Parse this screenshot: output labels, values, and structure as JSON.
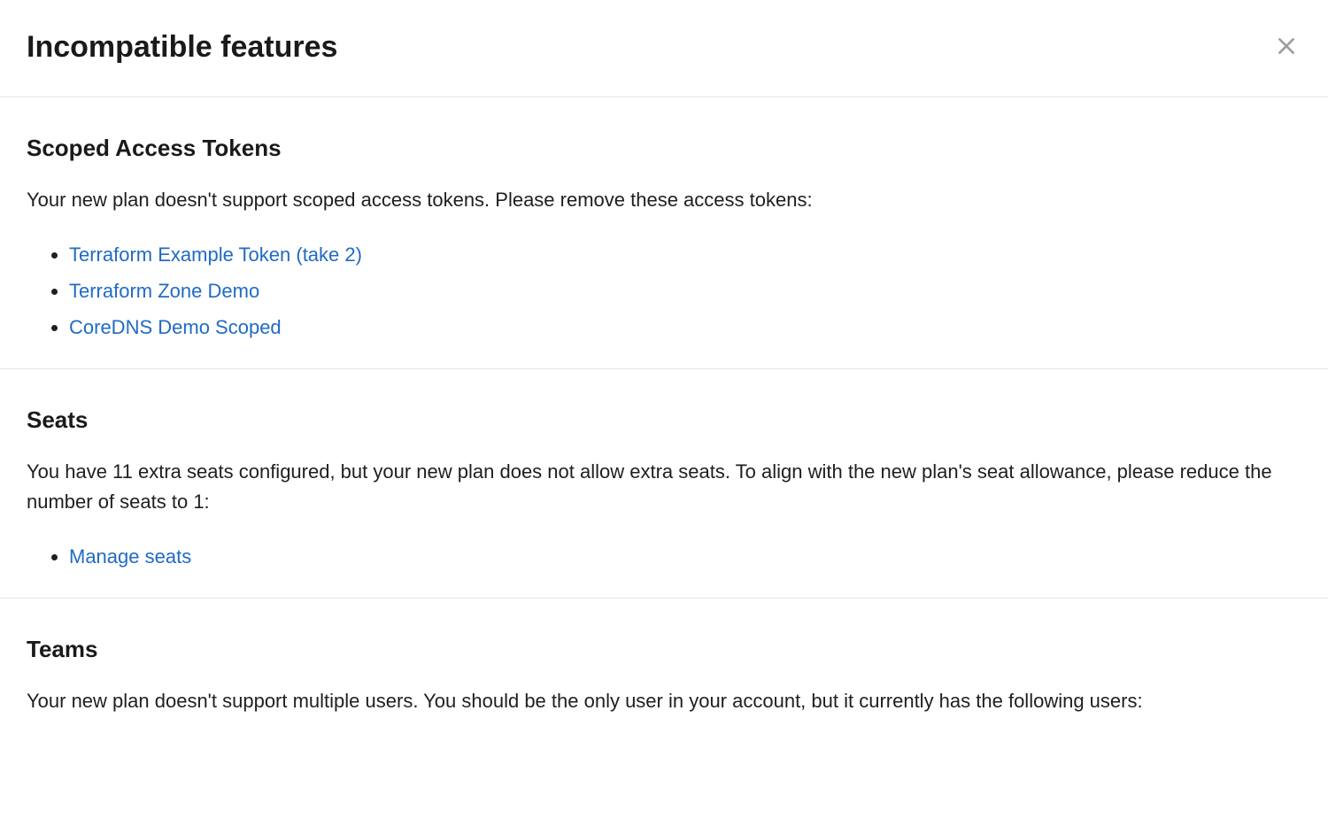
{
  "dialog": {
    "title": "Incompatible features"
  },
  "sections": {
    "tokens": {
      "title": "Scoped Access Tokens",
      "description": "Your new plan doesn't support scoped access tokens. Please remove these access tokens:",
      "items": [
        "Terraform Example Token (take 2)",
        "Terraform Zone Demo",
        "CoreDNS Demo Scoped"
      ]
    },
    "seats": {
      "title": "Seats",
      "description": "You have 11 extra seats configured, but your new plan does not allow extra seats. To align with the new plan's seat allowance, please reduce the number of seats to 1:",
      "items": [
        "Manage seats"
      ]
    },
    "teams": {
      "title": "Teams",
      "description": "Your new plan doesn't support multiple users. You should be the only user in your account, but it currently has the following users:"
    }
  }
}
